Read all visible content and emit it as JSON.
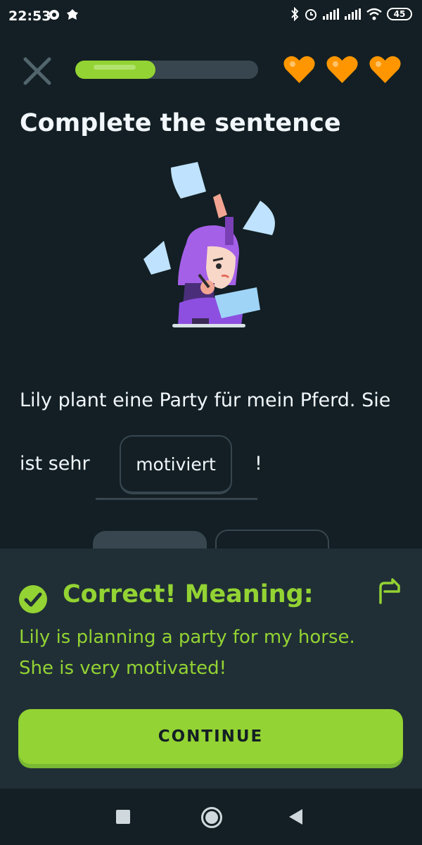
{
  "status_bar": {
    "time": "22:53",
    "battery": "45",
    "icons": [
      "notification-icon",
      "leaf-icon",
      "bluetooth-icon",
      "alarm-icon",
      "signal-icon",
      "signal-icon",
      "wifi-icon",
      "battery-icon"
    ]
  },
  "lesson": {
    "progress": 0.44,
    "hearts": 3,
    "title": "Complete the sentence",
    "sentence_line1": "Lily plant eine Party für mein Pferd. Sie",
    "sentence_pre": "ist sehr",
    "selected_word": "motiviert",
    "sentence_post": "!"
  },
  "feedback": {
    "title": "Correct! Meaning:",
    "meaning": "Lily is planning a party for my horse. She is very motivated!",
    "continue_label": "CONTINUE"
  },
  "colors": {
    "background": "#131f24",
    "accent_green": "#93d333",
    "heart_orange": "#ff9600",
    "sheet": "#202f36"
  }
}
